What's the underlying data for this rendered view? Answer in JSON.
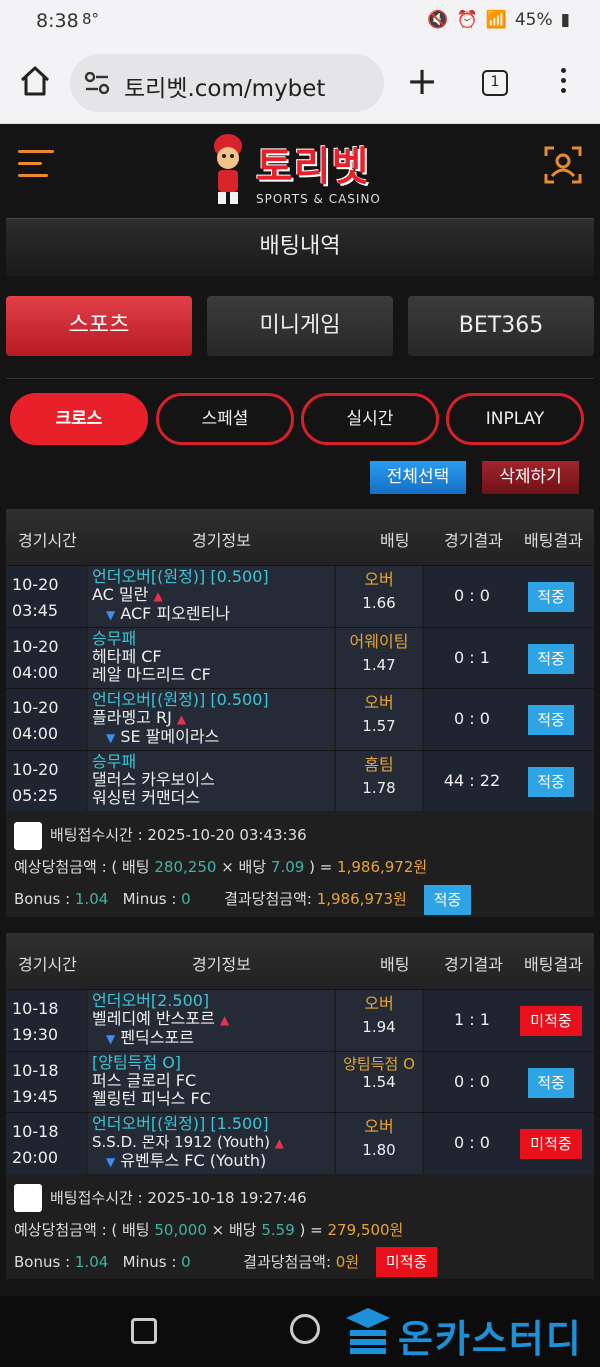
{
  "status": {
    "time": "8:38",
    "temp": "8°",
    "battery": "45%"
  },
  "browser": {
    "url": "토리벳.com/mybet",
    "tab_count": "1"
  },
  "site": {
    "brand": "토리벳",
    "brand_sub": "SPORTS & CASINO",
    "section_title": "배팅내역"
  },
  "tabs": [
    "스포츠",
    "미니게임",
    "BET365"
  ],
  "pills": [
    "크로스",
    "스페셜",
    "실시간",
    "INPLAY"
  ],
  "actions": {
    "select_all": "전체선택",
    "delete": "삭제하기"
  },
  "columns": [
    "경기시간",
    "경기정보",
    "배팅",
    "경기결과",
    "배팅결과"
  ],
  "slips": [
    {
      "rows": [
        {
          "date": "10-20",
          "time": "03:45",
          "market": "언더오버[(원정)] [0.500]",
          "home": "AC 밀란",
          "away": "ACF 피오렌티나",
          "pick": "오버",
          "odds": "1.66",
          "score": "0 : 0",
          "result": "적중"
        },
        {
          "date": "10-20",
          "time": "04:00",
          "market": "승무패",
          "home": "헤타페 CF",
          "away": "레알 마드리드 CF",
          "pick": "어웨이팀",
          "odds": "1.47",
          "score": "0 : 1",
          "result": "적중"
        },
        {
          "date": "10-20",
          "time": "04:00",
          "market": "언더오버[(원정)] [0.500]",
          "home": "플라멩고 RJ",
          "away": "SE 팔메이라스",
          "pick": "오버",
          "odds": "1.57",
          "score": "0 : 0",
          "result": "적중"
        },
        {
          "date": "10-20",
          "time": "05:25",
          "market": "승무패",
          "home": "댈러스 카우보이스",
          "away": "워싱턴 커맨더스",
          "pick": "홈팀",
          "odds": "1.78",
          "score": "44 : 22",
          "result": "적중"
        }
      ],
      "received_label": "배팅접수시간 : ",
      "received": "2025-10-20 03:43:36",
      "expected_label": "예상당첨금액 : ( 배팅 ",
      "stake": "280,250",
      "times_label": " × 배당 ",
      "total_odds": "7.09",
      "eq_label": " ) = ",
      "expected": "1,986,972원",
      "bonus_label": "Bonus : ",
      "bonus": "1.04",
      "minus_label": "Minus : ",
      "minus": "0",
      "payout_label": "결과당첨금액: ",
      "payout": "1,986,973원",
      "final": "적중"
    },
    {
      "rows": [
        {
          "date": "10-18",
          "time": "19:30",
          "market": "언더오버[2.500]",
          "home": "벨레디예 반스포르",
          "away": "펜딕스포르",
          "pick": "오버",
          "odds": "1.94",
          "score": "1 : 1",
          "result": "미적중"
        },
        {
          "date": "10-18",
          "time": "19:45",
          "market": "[양팀득점 O]",
          "home": "퍼스 글로리 FC",
          "away": "웰링턴 피닉스 FC",
          "pick": "양팀득점 O",
          "odds": "1.54",
          "score": "0 : 0",
          "result": "적중"
        },
        {
          "date": "10-18",
          "time": "20:00",
          "market": "언더오버[(원정)] [1.500]",
          "home": "S.S.D. 몬자 1912 (Youth)",
          "away": "유벤투스 FC (Youth)",
          "pick": "오버",
          "odds": "1.80",
          "score": "0 : 0",
          "result": "미적중"
        }
      ],
      "received_label": "배팅접수시간 : ",
      "received": "2025-10-18 19:27:46",
      "expected_label": "예상당첨금액 : ( 배팅 ",
      "stake": "50,000",
      "times_label": " × 배당 ",
      "total_odds": "5.59",
      "eq_label": " ) = ",
      "expected": "279,500원",
      "bonus_label": "Bonus : ",
      "bonus": "1.04",
      "minus_label": "Minus : ",
      "minus": "0",
      "payout_label": "결과당첨금액: ",
      "payout": "0원",
      "final": "미적중"
    }
  ],
  "watermark": "온카스터디",
  "colors": {
    "accent_red": "#e8202a",
    "win_blue": "#2fa4e5",
    "lose_red": "#e8101a",
    "market_cyan": "#3fc3d3",
    "pick_gold": "#e8a432"
  }
}
